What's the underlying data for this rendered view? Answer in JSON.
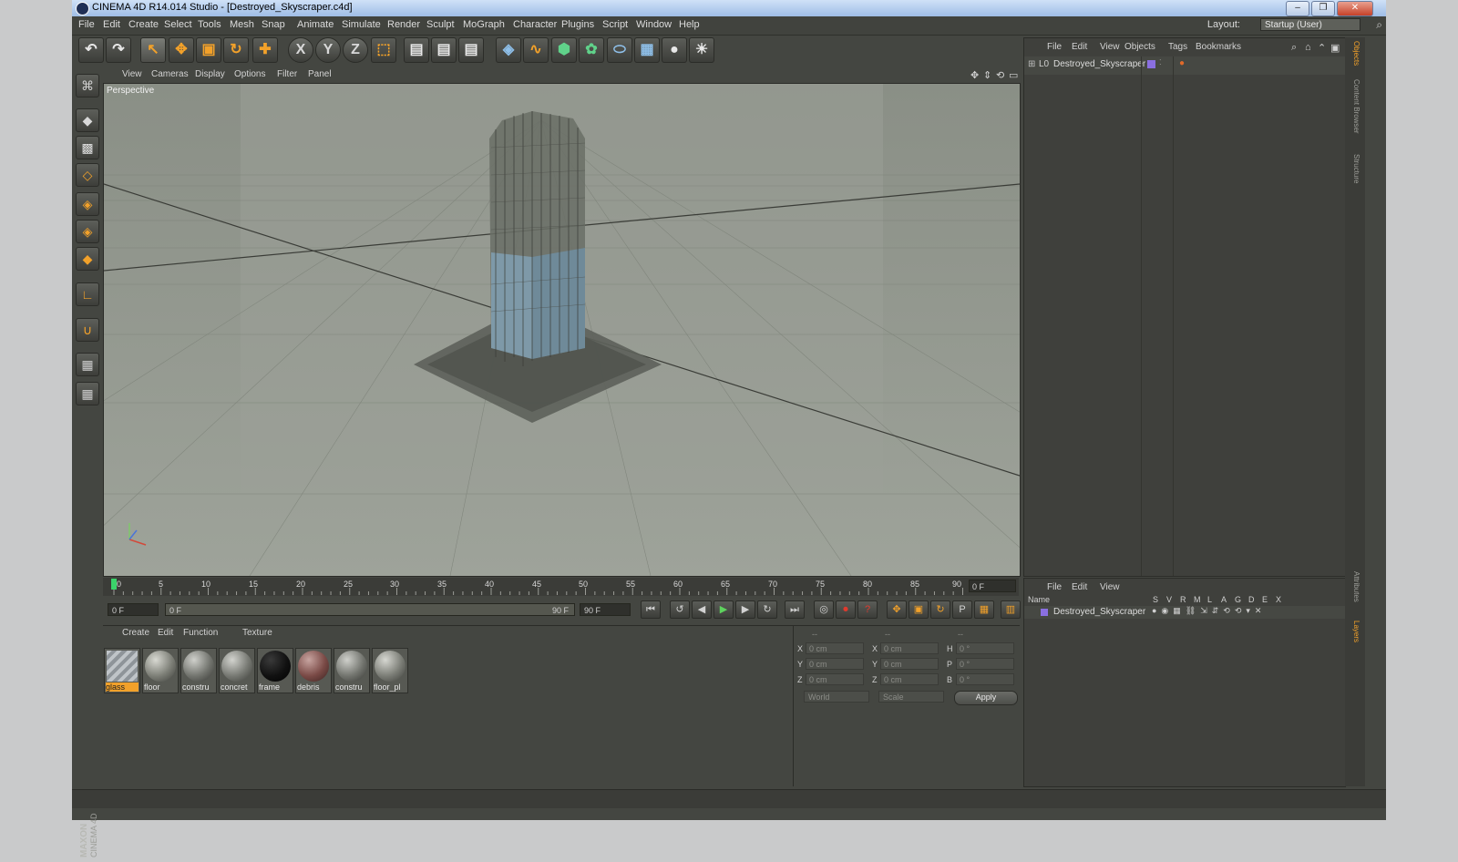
{
  "window": {
    "title": "CINEMA 4D R14.014 Studio - [Destroyed_Skyscraper.c4d]",
    "buttons": [
      "–",
      "❐",
      "✕"
    ]
  },
  "menubar": {
    "items": [
      "File",
      "Edit",
      "Create",
      "Select",
      "Tools",
      "Mesh",
      "Snap",
      "Animate",
      "Simulate",
      "Render",
      "Sculpt",
      "MoGraph",
      "Character",
      "Plugins",
      "Script",
      "Window",
      "Help"
    ],
    "layout_label": "Layout:",
    "layout_value": "Startup (User)"
  },
  "viewport": {
    "menu": [
      "View",
      "Cameras",
      "Display",
      "Options",
      "Filter",
      "Panel"
    ],
    "camera_label": "Perspective"
  },
  "timeline": {
    "ticks": [
      "0",
      "5",
      "10",
      "15",
      "20",
      "25",
      "30",
      "35",
      "40",
      "45",
      "50",
      "55",
      "60",
      "65",
      "70",
      "75",
      "80",
      "85",
      "90"
    ],
    "current_frame": "0 F"
  },
  "transport": {
    "start_field": "0 F",
    "range_start": "0 F",
    "range_end": "90 F",
    "end_field": "90 F"
  },
  "materials": {
    "menu": [
      "Create",
      "Edit",
      "Function",
      "Texture"
    ],
    "items": [
      {
        "name": "glass",
        "selected": true
      },
      {
        "name": "floor",
        "selected": false
      },
      {
        "name": "constru",
        "selected": false
      },
      {
        "name": "concret",
        "selected": false
      },
      {
        "name": "frame",
        "selected": false
      },
      {
        "name": "debris",
        "selected": false
      },
      {
        "name": "constru",
        "selected": false
      },
      {
        "name": "floor_pl",
        "selected": false
      }
    ]
  },
  "coordinates": {
    "headers": [
      "--",
      "--",
      "--"
    ],
    "pos_labels": [
      "X",
      "Y",
      "Z"
    ],
    "size_labels": [
      "X",
      "Y",
      "Z"
    ],
    "rot_labels": [
      "H",
      "P",
      "B"
    ],
    "pos_values": [
      "0 cm",
      "0 cm",
      "0 cm"
    ],
    "size_values": [
      "0 cm",
      "0 cm",
      "0 cm"
    ],
    "rot_values": [
      "0 °",
      "0 °",
      "0 °"
    ],
    "world_select": "World",
    "scale_select": "Scale",
    "apply_label": "Apply"
  },
  "object_manager": {
    "menu": [
      "File",
      "Edit",
      "View",
      "Objects",
      "Tags",
      "Bookmarks"
    ],
    "object_name": "Destroyed_Skyscraper"
  },
  "attribute_manager": {
    "menu": [
      "File",
      "Edit",
      "View"
    ],
    "name_header": "Name",
    "columns": [
      "S",
      "V",
      "R",
      "M",
      "L",
      "A",
      "G",
      "D",
      "E",
      "X"
    ],
    "object_name": "Destroyed_Skyscraper"
  },
  "side_tabs": [
    "Objects",
    "Content Browser",
    "Structure",
    "Attributes",
    "Layers"
  ],
  "branding": {
    "logo_text": "MAXON CINEMA 4D"
  },
  "colors": {
    "accent": "#f2a12a",
    "object_tag": "#8a6fe0"
  }
}
